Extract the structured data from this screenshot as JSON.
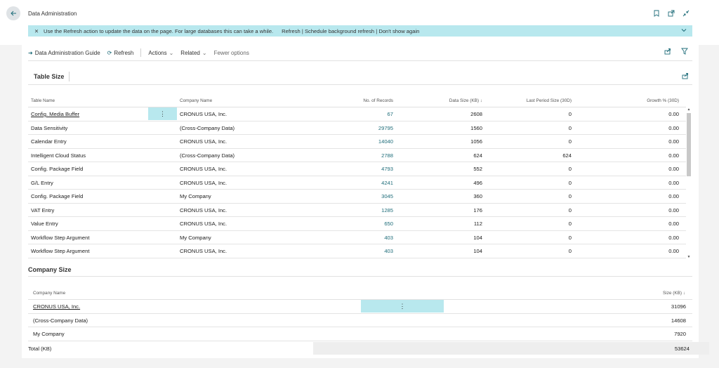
{
  "page": {
    "title": "Data Administration",
    "back_icon": "back-arrow-icon"
  },
  "notice": {
    "message": "Use the Refresh action to update the data on the page. For large databases this can take a while.",
    "links": "Refresh | Schedule background refresh | Don't show again"
  },
  "actions": {
    "guide": "Data Administration Guide",
    "refresh": "Refresh",
    "actions": "Actions",
    "related": "Related",
    "fewer": "Fewer options"
  },
  "table_size": {
    "title": "Table Size",
    "columns": {
      "table_name": "Table Name",
      "company_name": "Company Name",
      "records": "No. of Records",
      "data_size": "Data Size (KB) ↓",
      "last_period": "Last Period Size (30D)",
      "growth": "Growth % (30D)"
    },
    "rows": [
      {
        "table": "Config. Media Buffer",
        "company": "CRONUS USA, Inc.",
        "records": "67",
        "size": "2608",
        "last": "0",
        "growth": "0.00"
      },
      {
        "table": "Data Sensitivity",
        "company": "(Cross-Company Data)",
        "records": "29795",
        "size": "1560",
        "last": "0",
        "growth": "0.00"
      },
      {
        "table": "Calendar Entry",
        "company": "CRONUS USA, Inc.",
        "records": "14040",
        "size": "1056",
        "last": "0",
        "growth": "0.00"
      },
      {
        "table": "Intelligent Cloud Status",
        "company": "(Cross-Company Data)",
        "records": "2788",
        "size": "624",
        "last": "624",
        "growth": "0.00"
      },
      {
        "table": "Config. Package Field",
        "company": "CRONUS USA, Inc.",
        "records": "4793",
        "size": "552",
        "last": "0",
        "growth": "0.00"
      },
      {
        "table": "G/L Entry",
        "company": "CRONUS USA, Inc.",
        "records": "4241",
        "size": "496",
        "last": "0",
        "growth": "0.00"
      },
      {
        "table": "Config. Package Field",
        "company": "My Company",
        "records": "3045",
        "size": "360",
        "last": "0",
        "growth": "0.00"
      },
      {
        "table": "VAT Entry",
        "company": "CRONUS USA, Inc.",
        "records": "1285",
        "size": "176",
        "last": "0",
        "growth": "0.00"
      },
      {
        "table": "Value Entry",
        "company": "CRONUS USA, Inc.",
        "records": "650",
        "size": "112",
        "last": "0",
        "growth": "0.00"
      },
      {
        "table": "Workflow Step Argument",
        "company": "My Company",
        "records": "403",
        "size": "104",
        "last": "0",
        "growth": "0.00"
      },
      {
        "table": "Workflow Step Argument",
        "company": "CRONUS USA, Inc.",
        "records": "403",
        "size": "104",
        "last": "0",
        "growth": "0.00"
      }
    ]
  },
  "company_size": {
    "title": "Company Size",
    "columns": {
      "company_name": "Company Name",
      "size": "Size (KB) ↓"
    },
    "rows": [
      {
        "company": "CRONUS USA, Inc.",
        "size": "31096"
      },
      {
        "company": "(Cross-Company Data)",
        "size": "14608"
      },
      {
        "company": "My Company",
        "size": "7920"
      }
    ],
    "total_label": "Total (KB)",
    "total_value": "53624"
  },
  "colors": {
    "accent": "#1f6d7a",
    "notice_bg": "#b8e8ee"
  }
}
